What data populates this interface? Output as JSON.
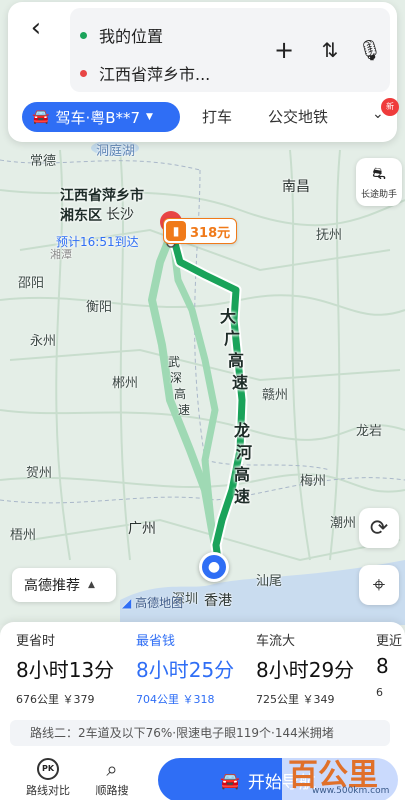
{
  "header": {
    "origin": "我的位置",
    "destination": "江西省萍乡市..."
  },
  "mode": {
    "selected": "驾车·粤B**7",
    "tabs": [
      "打车",
      "公交地铁"
    ],
    "badge": "新"
  },
  "map": {
    "dest_label_line1": "江西省萍乡市",
    "dest_label_line2": "湘东区",
    "eta": "预计16:51到达",
    "toll": "318元",
    "cities": {
      "changde": "常德",
      "dongting": "洞庭湖",
      "nanchang": "南昌",
      "changsha": "长沙",
      "fuzhou": "抚州",
      "shaoyang": "邵阳",
      "hengyang": "衡阳",
      "yongzhou": "永州",
      "chenzhou": "郴州",
      "ganzhou": "赣州",
      "longyan": "龙岩",
      "hezhou": "贺州",
      "meizhou": "梅州",
      "wuzhou": "梧州",
      "guangzhou": "广州",
      "chaozhou": "潮州",
      "shanwei": "汕尾",
      "shenzhen": "深圳",
      "hongkong": "香港",
      "xiangtan": "湘潭"
    },
    "roads": {
      "daguang": [
        "大",
        "广",
        "高",
        "速"
      ],
      "longhe": [
        "龙",
        "河",
        "高",
        "速"
      ],
      "wushen": [
        "武",
        "深",
        "高",
        "速"
      ]
    },
    "assistant_label": "长途助手",
    "route_pref": "高德推荐",
    "map_brand": "高德地图"
  },
  "routes": [
    {
      "tag": "更省时",
      "duration": "8小时13分",
      "meta": "676公里 ￥379"
    },
    {
      "tag": "最省钱",
      "duration": "8小时25分",
      "meta": "704公里 ￥318"
    },
    {
      "tag": "车流大",
      "duration": "8小时29分",
      "meta": "725公里 ￥349"
    },
    {
      "tag": "更近",
      "duration": "8",
      "meta": "6"
    }
  ],
  "route_info": "路线二：2车道及以下76%·限速电子眼119个·144米拥堵",
  "actions": {
    "compare": "路线对比",
    "along": "顺路搜",
    "start": "开始导航",
    "pk_icon_text": "PK"
  },
  "watermark": {
    "brand": "百公里",
    "url": "www.500km.com"
  },
  "colors": {
    "accent": "#2f6ef5",
    "route_main": "#1aa35a",
    "route_alt": "#9fd9b4",
    "toll_orange": "#f07a1a",
    "destination_red": "#e84545"
  }
}
